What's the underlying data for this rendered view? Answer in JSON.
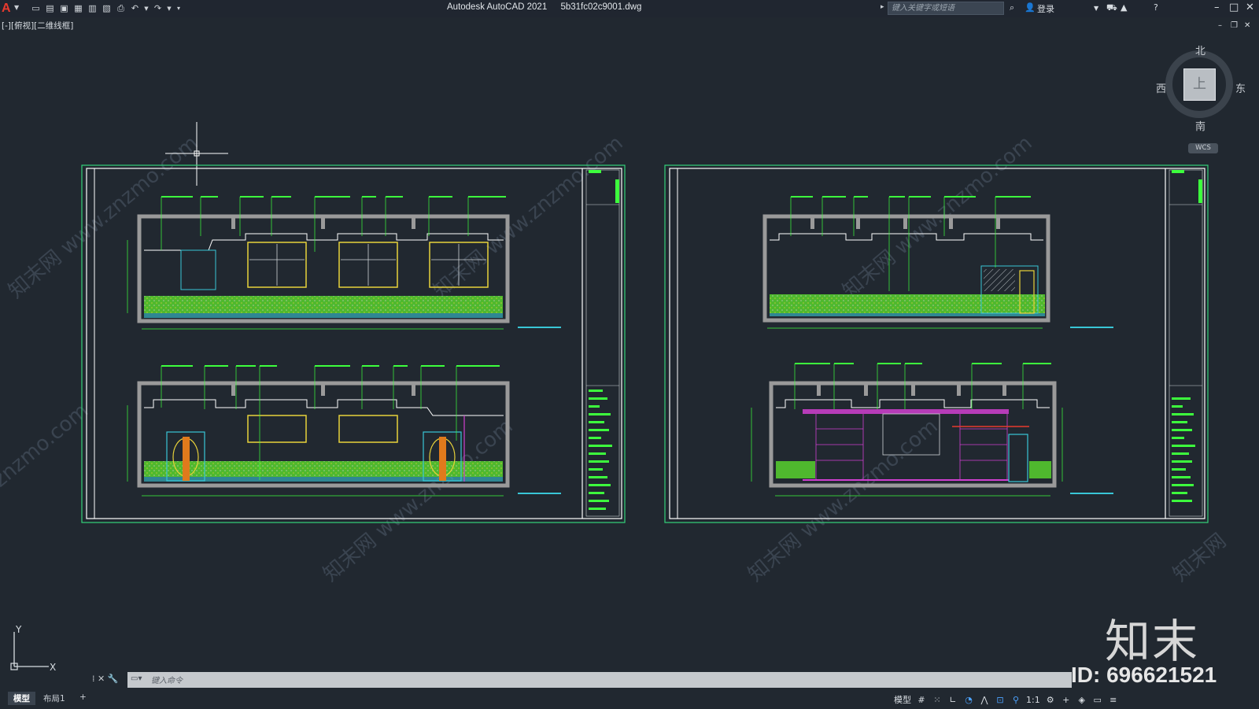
{
  "app": {
    "name": "Autodesk AutoCAD 2021",
    "file": "5b31fc02c9001.dwg",
    "search_placeholder": "键入关键字或短语",
    "login": "登录"
  },
  "viewport": {
    "label": "[-][俯视][二维线框]"
  },
  "viewcube": {
    "north": "北",
    "south": "南",
    "east": "东",
    "west": "西",
    "face": "上",
    "coord_system": "WCS"
  },
  "ucs": {
    "x": "X",
    "y": "Y"
  },
  "command": {
    "placeholder": "键入命令"
  },
  "layout_tabs": [
    "模型",
    "布局1",
    "+"
  ],
  "status": {
    "model_label": "模型",
    "scale": "1:1"
  },
  "brand": {
    "name": "知末",
    "id": "ID: 696621521",
    "watermark": "知末网 www.znzmo.com"
  },
  "colors": {
    "background": "#212830",
    "frame": "#33d17a",
    "wall": "#9a9a9a",
    "annotation": "#39c6d6",
    "text_green": "#3dff3d",
    "window": "#e8d23a",
    "door": "#e07a1c",
    "magenta": "#d03fd0"
  },
  "icons": [
    "new-icon",
    "open-icon",
    "save-icon",
    "save-as-icon",
    "plot-icon",
    "publish-icon",
    "print-icon",
    "undo-icon",
    "redo-icon"
  ]
}
